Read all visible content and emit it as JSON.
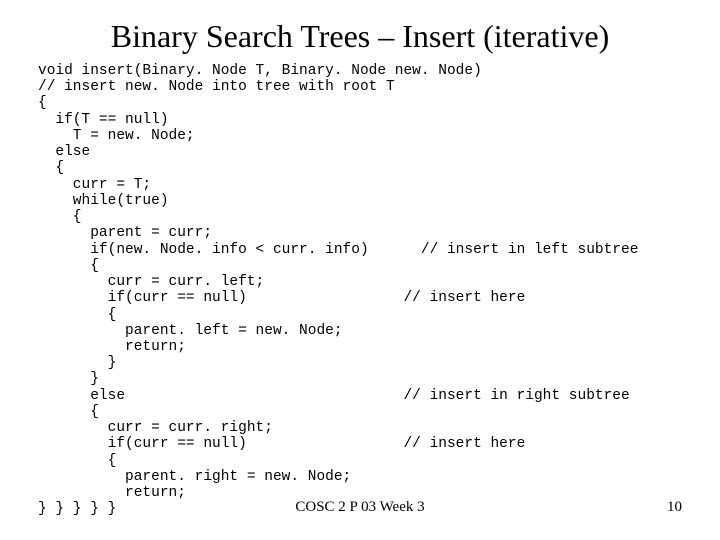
{
  "title": "Binary Search Trees – Insert (iterative)",
  "code": "void insert(Binary. Node T, Binary. Node new. Node)\n// insert new. Node into tree with root T\n{\n  if(T == null)\n    T = new. Node;\n  else\n  {\n    curr = T;\n    while(true)\n    {\n      parent = curr;\n      if(new. Node. info < curr. info)      // insert in left subtree\n      {\n        curr = curr. left;\n        if(curr == null)                  // insert here\n        {\n          parent. left = new. Node;\n          return;\n        }\n      }\n      else                                // insert in right subtree\n      {\n        curr = curr. right;\n        if(curr == null)                  // insert here\n        {\n          parent. right = new. Node;\n          return;\n} } } } }",
  "footer_center": "COSC 2 P 03 Week 3",
  "page_number": "10"
}
